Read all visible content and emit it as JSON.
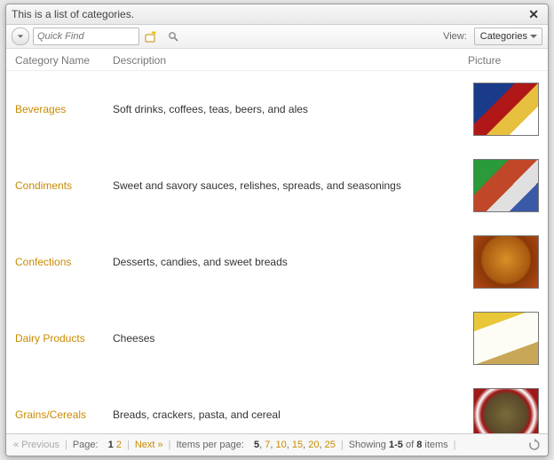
{
  "title": "This is a list of categories.",
  "toolbar": {
    "quickfind_placeholder": "Quick Find",
    "view_label": "View:",
    "view_selected": "Categories"
  },
  "headers": {
    "name": "Category Name",
    "desc": "Description",
    "pic": "Picture"
  },
  "rows": [
    {
      "name": "Beverages",
      "desc": "Soft drinks, coffees, teas, beers, and ales",
      "pic_class": "bev"
    },
    {
      "name": "Condiments",
      "desc": "Sweet and savory sauces, relishes, spreads, and seasonings",
      "pic_class": "cond"
    },
    {
      "name": "Confections",
      "desc": "Desserts, candies, and sweet breads",
      "pic_class": "conf"
    },
    {
      "name": "Dairy Products",
      "desc": "Cheeses",
      "pic_class": "dairy"
    },
    {
      "name": "Grains/Cereals",
      "desc": "Breads, crackers, pasta, and cereal",
      "pic_class": "grain"
    }
  ],
  "pager": {
    "prev": "« Previous",
    "page_label": "Page:",
    "pages": [
      "1",
      "2"
    ],
    "current_page": "1",
    "next": "Next »",
    "ipp_label": "Items per page:",
    "ipp_options": [
      "5",
      "7",
      "10",
      "15",
      "20",
      "25"
    ],
    "ipp_current": "5",
    "showing_prefix": "Showing ",
    "showing_range": "1-5",
    "showing_mid": " of ",
    "showing_total": "8",
    "showing_suffix": " items"
  }
}
